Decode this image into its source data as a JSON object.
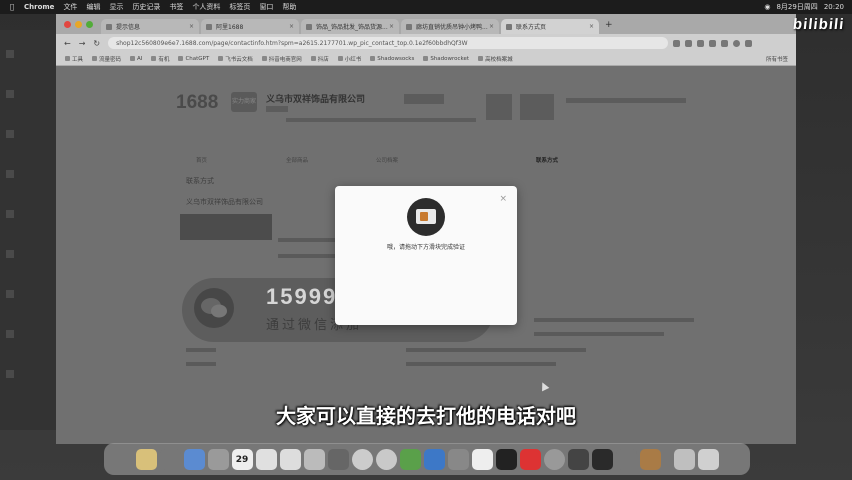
{
  "menubar": {
    "app_name": "Chrome",
    "items": [
      "文件",
      "编辑",
      "显示",
      "历史记录",
      "书签",
      "个人资料",
      "标签页",
      "窗口",
      "帮助"
    ],
    "date": "8月29日周四",
    "time": "20:20"
  },
  "tabs": [
    {
      "label": "提示信息"
    },
    {
      "label": "阿里1688"
    },
    {
      "label": "饰品_饰品批发_饰品货源..."
    },
    {
      "label": "廊坊直销优质吊钟小烤鸭..."
    },
    {
      "label": "联系方式页",
      "active": true
    }
  ],
  "address": {
    "url": "shop12c560809e6e7.1688.com/page/contactinfo.htm?spm=a2615.2177701.wp_pic_contact_top.0.1e2f60bbdhQf3W"
  },
  "bookmarks": [
    "工具",
    "流量密码",
    "AI",
    "有机",
    "ChatGPT",
    "飞书云文档",
    "抖音电商官网",
    "抖店",
    "小红书",
    "Shadowsocks",
    "Shadowrocket",
    "高校档案城"
  ],
  "bookmarks_all": "所有书签",
  "page": {
    "logo": "1688",
    "shop_badge": "实力商家",
    "company_name": "义乌市双祥饰品有限公司",
    "section_title": "联系方式",
    "company_name_2": "义乌市双祥饰品有限公司",
    "nav": [
      "首页",
      "全部商品",
      "公司档案",
      "联系方式"
    ],
    "contact_phone": "15999018",
    "contact_sub": "通过微信添加"
  },
  "modal": {
    "message": "哦，请拖动下方滑块完成验证"
  },
  "subtitle": "大家可以直接的去打他的电话对吧",
  "dock_calendar_day": "29",
  "watermark": "bilibili"
}
